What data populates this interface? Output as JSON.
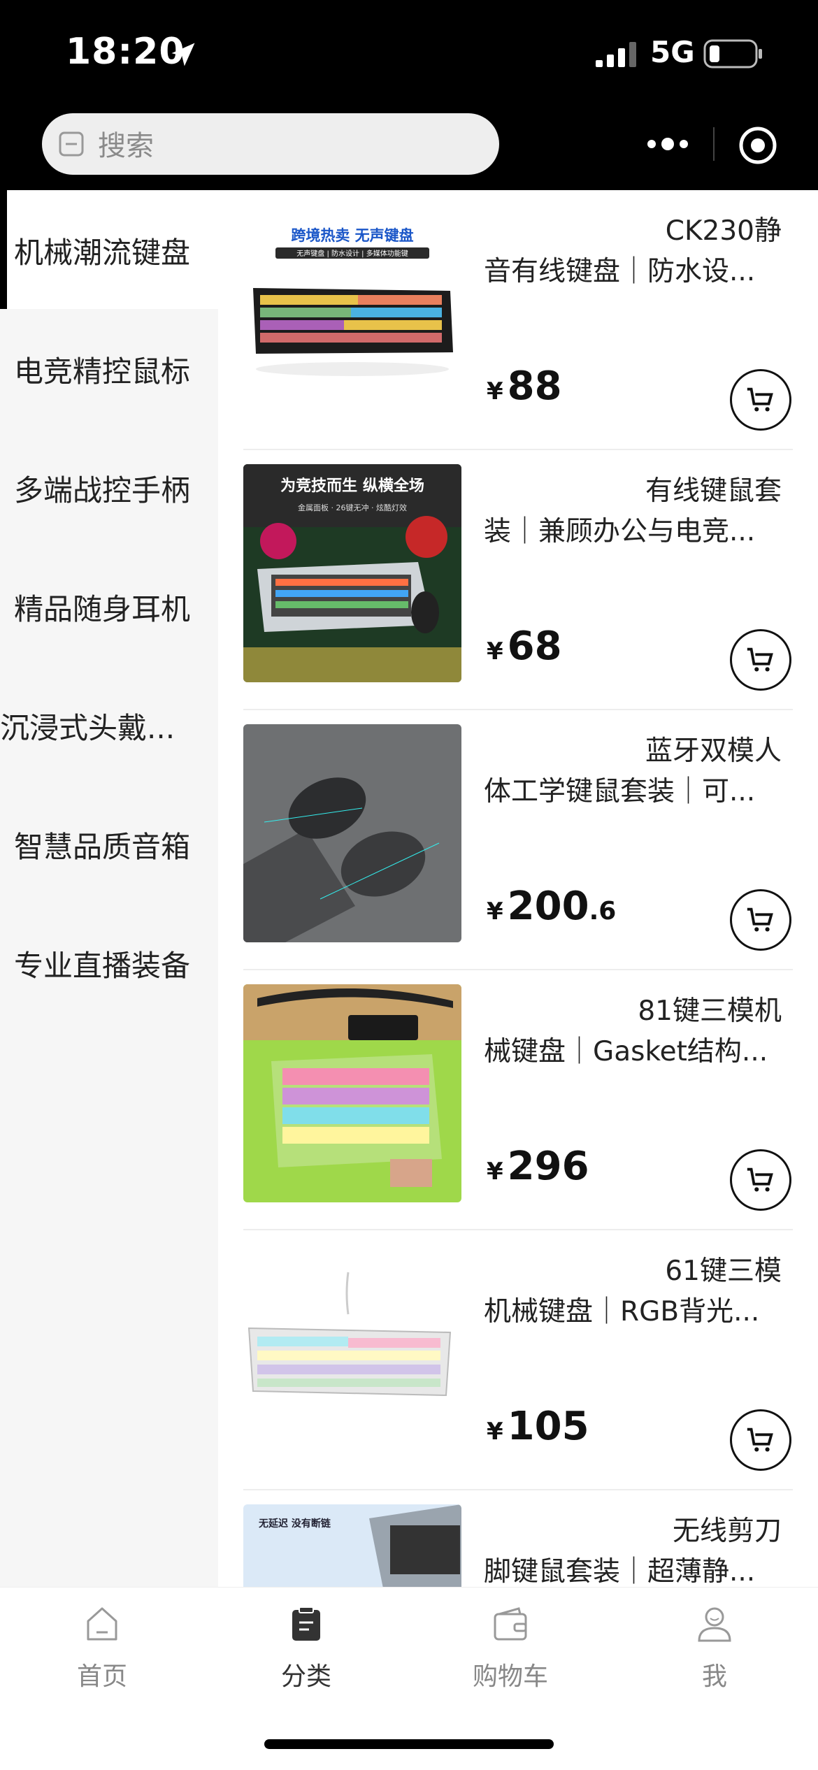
{
  "status_bar": {
    "time": "18:20",
    "network": "5G"
  },
  "search": {
    "placeholder": "搜索"
  },
  "sidebar": {
    "items": [
      {
        "label": "机械潮流键盘",
        "active": true
      },
      {
        "label": "电竞精控鼠标"
      },
      {
        "label": "多端战控手柄"
      },
      {
        "label": "精品随身耳机"
      },
      {
        "label": "沉浸式头戴..."
      },
      {
        "label": "智慧品质音箱"
      },
      {
        "label": "专业直播装备"
      }
    ]
  },
  "products": [
    {
      "title_line1": "CK230静",
      "title_line2": "音有线键盘｜防水设...",
      "currency": "¥",
      "price_int": "88",
      "price_dec": ""
    },
    {
      "title_line1": "有线键鼠套",
      "title_line2": "装｜兼顾办公与电竞...",
      "currency": "¥",
      "price_int": "68",
      "price_dec": ""
    },
    {
      "title_line1": "蓝牙双模人",
      "title_line2": "体工学键鼠套装｜可...",
      "currency": "¥",
      "price_int": "200",
      "price_dec": ".6"
    },
    {
      "title_line1": "81键三模机",
      "title_line2": "械键盘｜Gasket结构...",
      "currency": "¥",
      "price_int": "296",
      "price_dec": ""
    },
    {
      "title_line1": "61键三模",
      "title_line2": "机械键盘｜RGB背光...",
      "currency": "¥",
      "price_int": "105",
      "price_dec": ""
    },
    {
      "title_line1": "无线剪刀",
      "title_line2": "脚键鼠套装｜超薄静...",
      "currency": "",
      "price_int": "",
      "price_dec": ""
    }
  ],
  "product_images": {
    "p1_banner": "跨境热卖 无声键盘",
    "p1_sub": "无声键盘 | 防水设计 | 多媒体功能键",
    "p2_banner": "为竞技而生  纵横全场",
    "p2_sub": "金属面板 · 26键无冲 · 炫酷灯效",
    "p6_badge": "无延迟 没有断链"
  },
  "tabbar": {
    "tabs": [
      {
        "label": "首页",
        "icon": "home-icon"
      },
      {
        "label": "分类",
        "icon": "category-icon",
        "active": true
      },
      {
        "label": "购物车",
        "icon": "wallet-cart-icon"
      },
      {
        "label": "我",
        "icon": "profile-icon"
      }
    ]
  },
  "colors": {
    "topbar": "#000000",
    "sidebar_bg": "#f6f6f6",
    "accent": "#000000"
  }
}
